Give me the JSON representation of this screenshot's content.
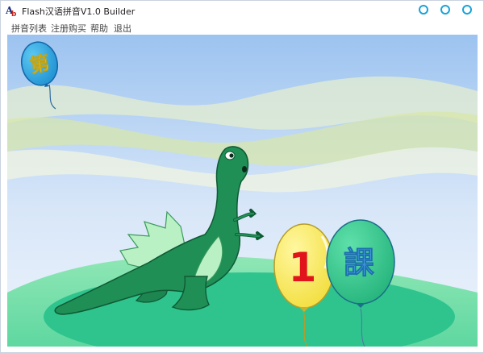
{
  "window": {
    "title": "Flash汉语拼音V1.0 Builder",
    "icon": "app-logo-icon",
    "controls": [
      "minimize-icon",
      "maximize-icon",
      "close-icon"
    ],
    "accent_color": "#1aa3d9"
  },
  "menu": {
    "items": [
      {
        "label": "拼音列表"
      },
      {
        "label": "注册购买"
      },
      {
        "label": "帮助"
      },
      {
        "label": "退出"
      }
    ]
  },
  "scene": {
    "balloon_small_char": "第",
    "balloon_yellow_char": "1",
    "balloon_green_char": "課",
    "colors": {
      "sky_top": "#9cc3f0",
      "sky_bottom": "#e4eefb",
      "grass": "#34c98f",
      "dinosaur": "#1f8f55",
      "balloon_small": "#2aa8e0",
      "balloon_yellow": "#f7ea55",
      "balloon_green": "#2fc48a"
    }
  }
}
